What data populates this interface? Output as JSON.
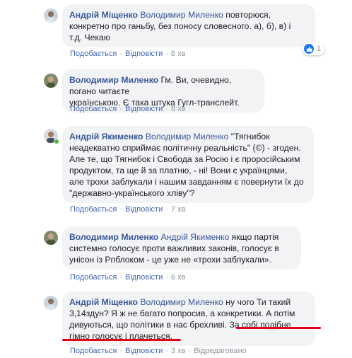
{
  "comments": [
    {
      "author": "Андрій Міщенко",
      "mention": "Володимир Миленко",
      "text_lines": [
        "повторюся,",
        "конкретно про ганьбу, без поносу словесного. а), б), в) і",
        "т.д. Чекаю"
      ],
      "like": "Подобається",
      "reply": "Відповісти",
      "time": "8 хв",
      "reaction_count": "1"
    },
    {
      "author": "Володимир Миленко",
      "text_lines": [
        "Гм. Ви, очевидно, погано читаєте",
        "українською. Є така штука Гугл-транслейт."
      ],
      "like": "Подобається",
      "reply": "Відповісти",
      "time": "8 хв"
    },
    {
      "author": "Андрій Якименко",
      "mention": "Володимир Миленко",
      "text_lines": [
        "\"Тягнибок",
        "неадекватно сприймає політичну реальність\" (©) - згоден.",
        "Але те, що Тягнибок і Свобода за Росію і є проросійським",
        "продуктом, та ще й за платню, - ні! Вони є українцями,",
        "але трохи заблукали і нашим завданням є повернути їх до",
        "\"державно-українського хліву\"?"
      ],
      "like": "Подобається",
      "reply": "Відповісти",
      "time": "7 хв"
    },
    {
      "author": "Володимир Миленко",
      "mention": "Андрій Якименко",
      "text_lines": [
        "якщо партія",
        "системно голосує проти важливих законів, голосує в",
        "унісон із Рпблоком - це уже не «трохи заблукали»."
      ],
      "like": "Подобається",
      "reply": "Відповісти",
      "time": "6 хв"
    },
    {
      "author": "Андрій Міщенко",
      "mention": "Володимир Миленко",
      "text_lines": [
        "ну чого Ти такий",
        "3,14здун? Я ж не багато попросив, а конкретики. А потім",
        "дивуються, що політики в нас брехливі. За собі подібне",
        "гімно голосує і плачеться."
      ],
      "like": "Подобається",
      "reply": "Відповісти",
      "time": "3 хв",
      "edited": "Відредаговано"
    }
  ],
  "colors": {
    "link": "#385898",
    "bubble": "#f2f3f5",
    "action_link": "#4267b2",
    "meta": "#90949c",
    "online": "#42b72a",
    "underline": "#e0001a",
    "like_badge": "#1877f2"
  },
  "icons": [
    "avatar-image",
    "online-status-icon",
    "like-reaction-icon"
  ]
}
